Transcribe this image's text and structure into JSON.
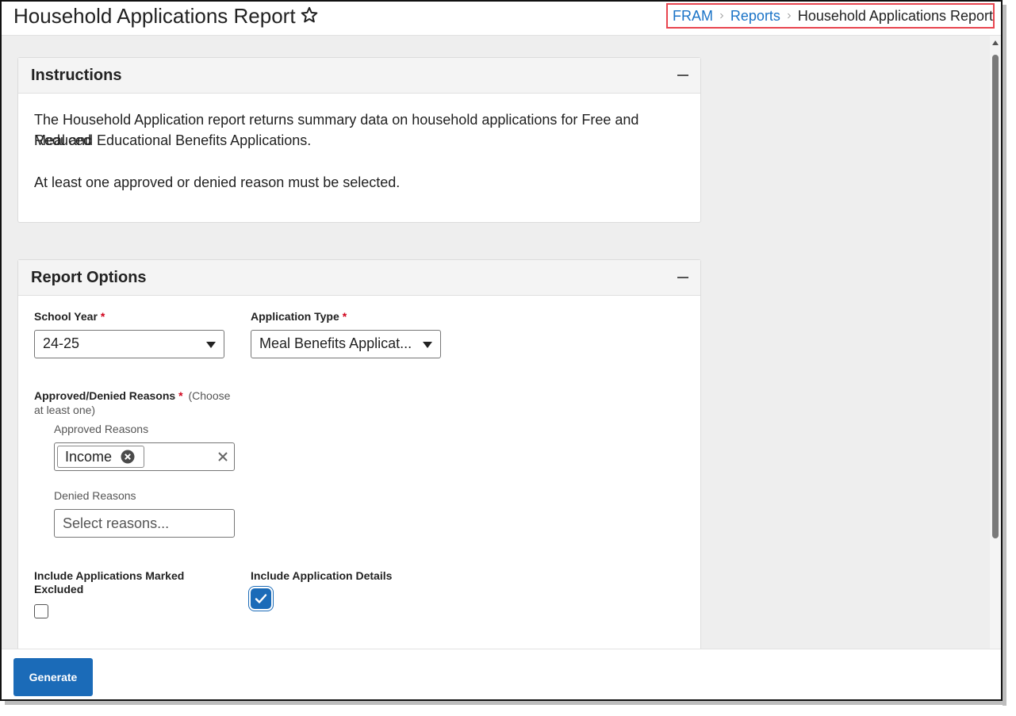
{
  "header": {
    "title": "Household Applications Report",
    "favorite_icon": "star-outline-icon",
    "breadcrumb": {
      "items": [
        "FRAM",
        "Reports"
      ],
      "current": "Household Applications Report",
      "highlight_color": "#e8454f"
    }
  },
  "instructions": {
    "title": "Instructions",
    "paragraphs": [
      "The Household Application report returns summary data on household applications for Free and Reduced",
      "Meal and Educational Benefits Applications.",
      "At least one approved or denied reason must be selected."
    ]
  },
  "report_options": {
    "title": "Report Options",
    "school_year": {
      "label": "School Year",
      "required": "*",
      "value": "24-25"
    },
    "application_type": {
      "label": "Application Type",
      "required": "*",
      "value": "Meal Benefits Applicat..."
    },
    "reasons": {
      "label": "Approved/Denied Reasons",
      "required": "*",
      "hint_line1": "(Choose",
      "hint_line2": "at least one)",
      "approved": {
        "label": "Approved Reasons",
        "chips": [
          "Income"
        ]
      },
      "denied": {
        "label": "Denied Reasons",
        "placeholder": "Select reasons..."
      }
    },
    "include_excluded": {
      "label_line1": "Include Applications Marked",
      "label_line2": "Excluded",
      "checked": false
    },
    "include_details": {
      "label": "Include Application Details",
      "checked": true
    }
  },
  "footer": {
    "generate_label": "Generate"
  },
  "colors": {
    "accent": "#1b6bb8",
    "link": "#1a73c7",
    "required": "#d0021b"
  }
}
